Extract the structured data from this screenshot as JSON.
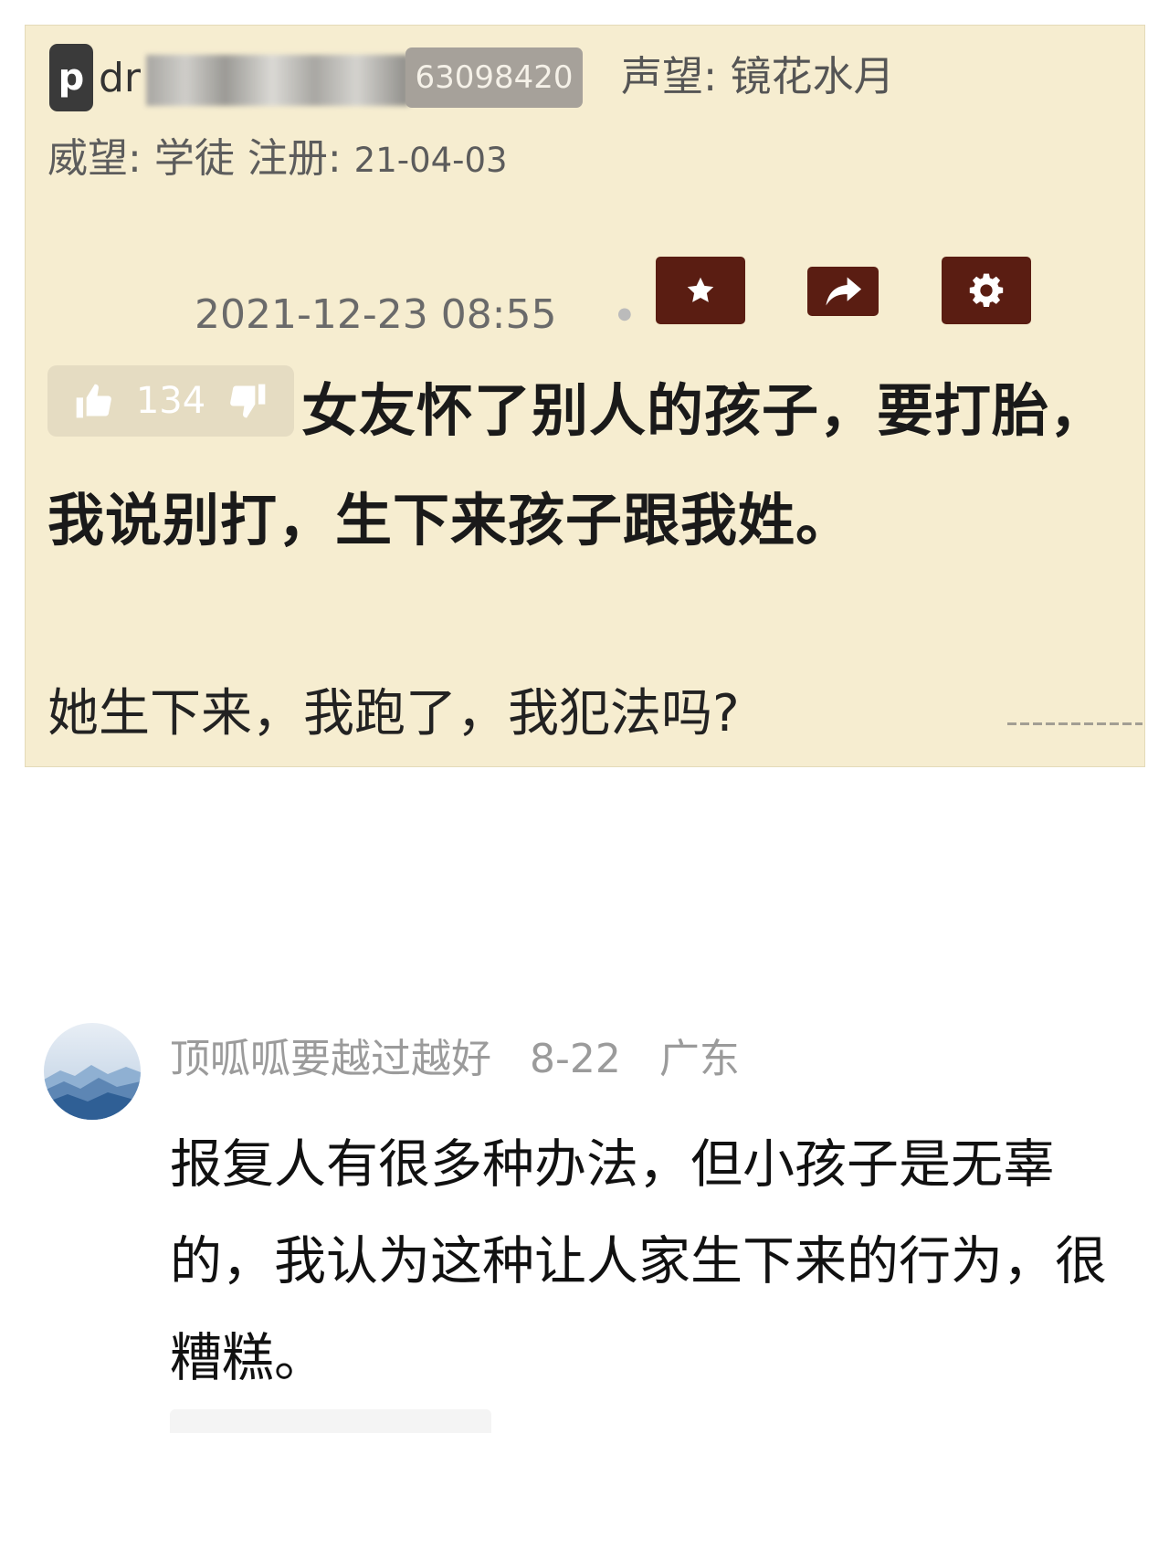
{
  "forum_post": {
    "username_visible": "dr",
    "user_id": "63098420",
    "reputation_label": "声望:",
    "reputation_value": "镜花水月",
    "prestige_label": "威望:",
    "prestige_value": "学徒",
    "registered_label": "注册:",
    "registered_date": "21-04-03",
    "post_time": "2021-12-23 08:55",
    "vote_count": "134",
    "title": "女友怀了别人的孩子，要打胎，我说别打，生下来孩子跟我姓。",
    "body": "她生下来，我跑了，我犯法吗?",
    "icons": {
      "logo": "p",
      "star": "star-icon",
      "share": "share-arrow-icon",
      "settings": "gear-icon",
      "like": "thumbs-up-icon",
      "dislike": "thumbs-down-icon"
    }
  },
  "comment": {
    "author": "顶呱呱要越过越好",
    "date": "8-22",
    "location": "广东",
    "text": "报复人有很多种办法，但小孩子是无辜的，我认为这种让人家生下来的行为，很糟糕。"
  },
  "colors": {
    "forum_bg": "#f6edd0",
    "action_button": "#5a1d12",
    "badge": "#a6a19a"
  }
}
